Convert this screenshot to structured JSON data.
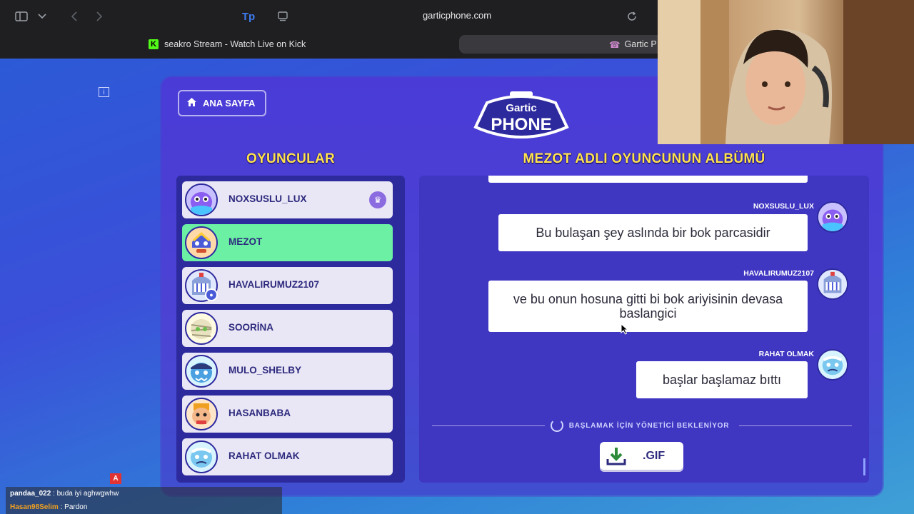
{
  "browser": {
    "url": "garticphone.com",
    "tabs": [
      {
        "title": "seakro Stream - Watch Live on Kick"
      },
      {
        "title": "Gartic P"
      }
    ],
    "icons": [
      "sidebar-icon",
      "chevron-down-icon",
      "back-icon",
      "forward-icon",
      "tp-icon",
      "reader-icon",
      "reload-icon"
    ]
  },
  "game": {
    "home_label": "ANA SAYFA",
    "logo_top": "Gartic",
    "logo_bottom": "PHONE",
    "players_title": "OYUNCULAR",
    "album_title": "MEZOT ADLI OYUNCUNUN ALBÜMÜ",
    "players": [
      {
        "name": "NOXSUSLU_LUX"
      },
      {
        "name": "MEZOT"
      },
      {
        "name": "HAVALIRUMUZ2107"
      },
      {
        "name": "SOORİNA"
      },
      {
        "name": "MULO_SHELBY"
      },
      {
        "name": "HASANBABA"
      },
      {
        "name": "RAHAT OLMAK"
      }
    ],
    "messages": [
      {
        "author": "NOXSUSLU_LUX",
        "text": "Bu bulaşan şey aslında bir bok parcasidir"
      },
      {
        "author": "HAVALIRUMUZ2107",
        "text": "ve bu onun hosuna gitti bi bok ariyisinin devasa baslangici"
      },
      {
        "author": "RAHAT OLMAK",
        "text": "başlar başlamaz bıttı"
      }
    ],
    "waiting_text": "BAŞLAMAK İÇİN YÖNETİCİ BEKLENİYOR",
    "gif_label": ".GIF"
  },
  "chat": [
    {
      "user": "pandaa_022",
      "text": "buda iyi aghwgwhw",
      "color": "#ffffff"
    },
    {
      "user": "Hasan98Selim",
      "text": "Pardon",
      "color": "#f0a020"
    }
  ],
  "chat_badge": "A",
  "colors": {
    "accent_title": "#ffe34d",
    "active_player": "#6bf0a4",
    "panel": "#4a3bd6"
  }
}
